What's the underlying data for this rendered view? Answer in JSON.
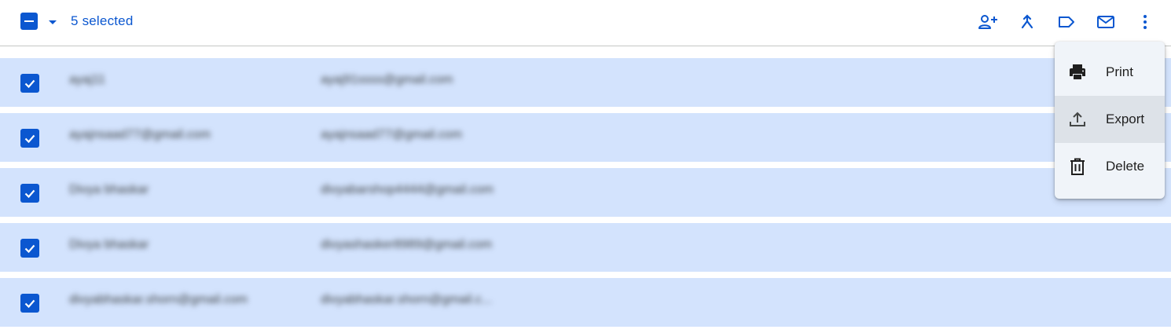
{
  "toolbar": {
    "selected_label": "5 selected",
    "icons": [
      "add-person-icon",
      "merge-icon",
      "label-icon",
      "email-icon",
      "more-vert-icon"
    ]
  },
  "rows": [
    {
      "name": "ayaj11",
      "email": "ayaj91ssss@gmail.com",
      "checked": true
    },
    {
      "name": "ayajnsaad77@gmail.com",
      "email": "ayajnsaad77@gmail.com",
      "checked": true
    },
    {
      "name": "Divya bhaskar",
      "email": "divyabarshop4444@gmail.com",
      "checked": true
    },
    {
      "name": "Divya bhaskar",
      "email": "divyashasker8989@gmail.com",
      "checked": true
    },
    {
      "name": "divyabhaskar.shorn@gmail.com",
      "email": "divyabhaskar.shorn@gmail.c...",
      "checked": true
    }
  ],
  "menu": {
    "items": [
      {
        "label": "Print",
        "icon": "print-icon"
      },
      {
        "label": "Export",
        "icon": "upload-icon",
        "highlighted": true
      },
      {
        "label": "Delete",
        "icon": "trash-icon"
      }
    ]
  },
  "colors": {
    "accent": "#0b57d0",
    "row_selected_bg": "#d3e3fd",
    "menu_bg": "#f0f4f9",
    "menu_hover_bg": "#dde2e8"
  }
}
